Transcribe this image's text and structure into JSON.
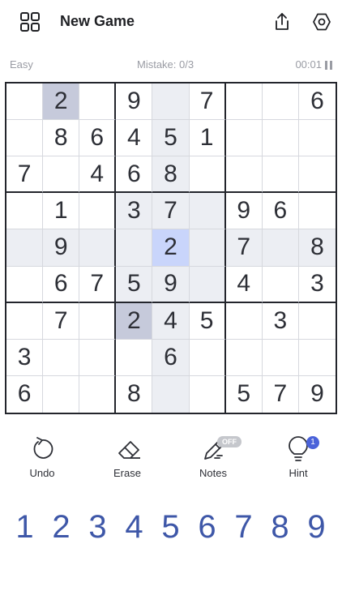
{
  "header": {
    "title": "New Game"
  },
  "status": {
    "difficulty": "Easy",
    "mistakes": "Mistake: 0/3",
    "timer": "00:01"
  },
  "board": {
    "cells": [
      [
        "",
        "2",
        "",
        "9",
        "",
        "7",
        "",
        "",
        "6"
      ],
      [
        "",
        "8",
        "6",
        "4",
        "5",
        "1",
        "",
        "",
        ""
      ],
      [
        "7",
        "",
        "4",
        "6",
        "8",
        "",
        "",
        "",
        ""
      ],
      [
        "",
        "1",
        "",
        "3",
        "7",
        "",
        "9",
        "6",
        ""
      ],
      [
        "",
        "9",
        "",
        "",
        "2",
        "",
        "7",
        "",
        "8"
      ],
      [
        "",
        "6",
        "7",
        "5",
        "9",
        "",
        "4",
        "",
        "3"
      ],
      [
        "",
        "7",
        "",
        "2",
        "4",
        "5",
        "",
        "3",
        ""
      ],
      [
        "3",
        "",
        "",
        "",
        "6",
        "",
        "",
        "",
        ""
      ],
      [
        "6",
        "",
        "",
        "8",
        "",
        "",
        "5",
        "7",
        "9"
      ]
    ],
    "selected": {
      "row": 4,
      "col": 4
    },
    "same_number_cells": [
      [
        0,
        1
      ],
      [
        6,
        3
      ]
    ],
    "colors": {
      "selected": "#c9d5fb",
      "same_number": "#c6cadb",
      "related": "#eceef3",
      "thick_line": "#23252c",
      "thin_line": "#d6d8de"
    }
  },
  "tools": {
    "undo_label": "Undo",
    "erase_label": "Erase",
    "notes_label": "Notes",
    "notes_state": "OFF",
    "hint_label": "Hint",
    "hint_count": "1"
  },
  "numpad": [
    "1",
    "2",
    "3",
    "4",
    "5",
    "6",
    "7",
    "8",
    "9"
  ],
  "icons": {
    "menu": "grid-menu-icon",
    "share": "share-icon",
    "settings": "hexagon-settings-icon",
    "pause": "pause-icon",
    "undo": "undo-icon",
    "erase": "eraser-icon",
    "notes": "pencil-icon",
    "hint": "lightbulb-icon"
  },
  "accent_color": "#3e57a8"
}
